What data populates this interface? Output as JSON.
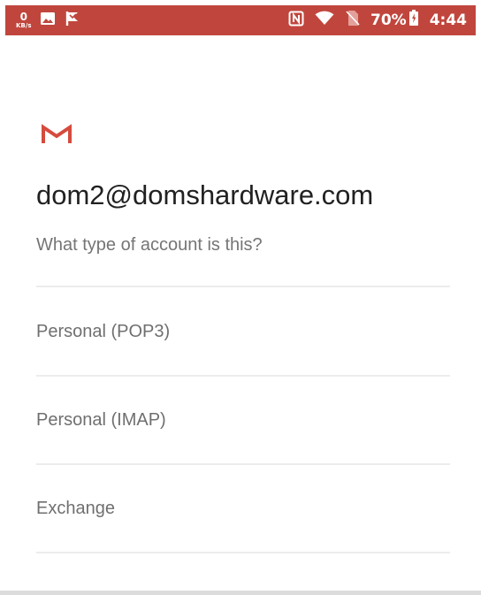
{
  "status_bar": {
    "net_speed_value": "0",
    "net_speed_unit": "KB/s",
    "battery_percent": "70%",
    "time": "4:44",
    "icons": [
      "image-icon",
      "flag-icon",
      "nfc-icon",
      "wifi-icon",
      "no-sim-icon",
      "battery-icon"
    ],
    "color": "#c0463d"
  },
  "header": {
    "logo": "gmail-logo",
    "email": "dom2@domshardware.com",
    "subtitle": "What type of account is this?"
  },
  "account_types": [
    {
      "label": "Personal (POP3)"
    },
    {
      "label": "Personal (IMAP)"
    },
    {
      "label": "Exchange"
    }
  ],
  "colors": {
    "gmail_red": "#d54b3d",
    "heading": "#212121",
    "secondary_text": "#757575",
    "divider": "#ececec"
  }
}
